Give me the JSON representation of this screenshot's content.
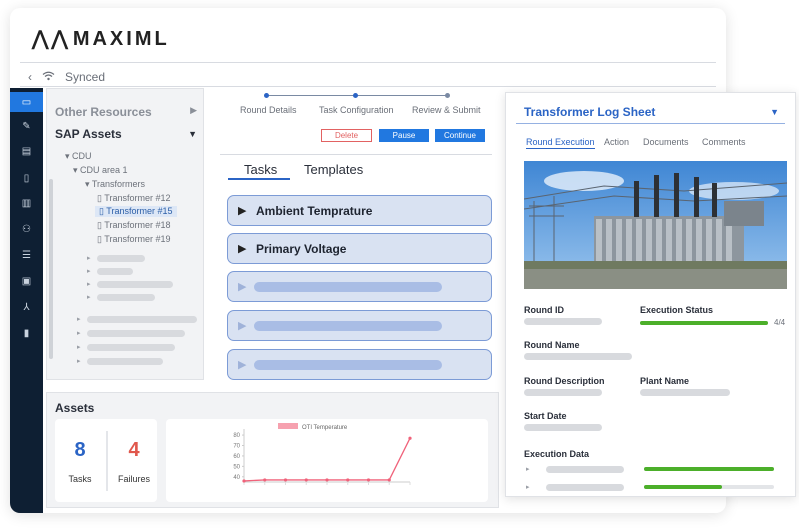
{
  "app": {
    "logo": "MAXIML",
    "sync_status": "Synced"
  },
  "rail": {
    "icons": [
      "folder-icon",
      "wrench-icon",
      "clipboard-icon",
      "file-icon",
      "bar-chart-icon",
      "users-icon",
      "list-icon",
      "image-icon",
      "hierarchy-icon",
      "bookmark-icon"
    ]
  },
  "resources": {
    "other_label": "Other Resources",
    "sap_label": "SAP Assets",
    "tree": {
      "root": "CDU",
      "area": "CDU area 1",
      "group": "Transformers",
      "items": [
        "Transformer #12",
        "Transformer #15",
        "Transformer #18",
        "Transformer #19"
      ],
      "selected_index": 1
    }
  },
  "stepper": {
    "steps": [
      "Round Details",
      "Task Configuration",
      "Review & Submit"
    ]
  },
  "actions": {
    "delete": "Delete",
    "pause": "Pause",
    "continue": "Continue"
  },
  "tabs": {
    "tasks": "Tasks",
    "templates": "Templates"
  },
  "tasks": [
    "Ambient Temprature",
    "Primary Voltage"
  ],
  "assets": {
    "title": "Assets",
    "tasks_count": "8",
    "tasks_label": "Tasks",
    "failures_count": "4",
    "failures_label": "Failures"
  },
  "chart_data": {
    "type": "line",
    "legend": "OTI Temperature",
    "x": [
      1,
      2,
      3,
      4,
      5,
      6,
      7,
      8,
      9
    ],
    "values": [
      36,
      37,
      37,
      37,
      37,
      37,
      37,
      37,
      77
    ],
    "yticks": [
      "80",
      "70",
      "60",
      "50",
      "40"
    ],
    "ylim": [
      35,
      82
    ],
    "color": "#f0627a"
  },
  "logsheet": {
    "title": "Transformer Log Sheet",
    "tabs": [
      "Round Execution",
      "Action",
      "Documents",
      "Comments"
    ],
    "round_id_label": "Round ID",
    "execution_status_label": "Execution Status",
    "execution_status_value": "4/4",
    "execution_progress": 1.0,
    "round_name_label": "Round Name",
    "round_description_label": "Round Description",
    "plant_name_label": "Plant Name",
    "start_date_label": "Start Date",
    "execution_data_label": "Execution Data",
    "execution_data_progress": [
      1.0,
      0.6
    ],
    "accent": "#4caf2a"
  }
}
